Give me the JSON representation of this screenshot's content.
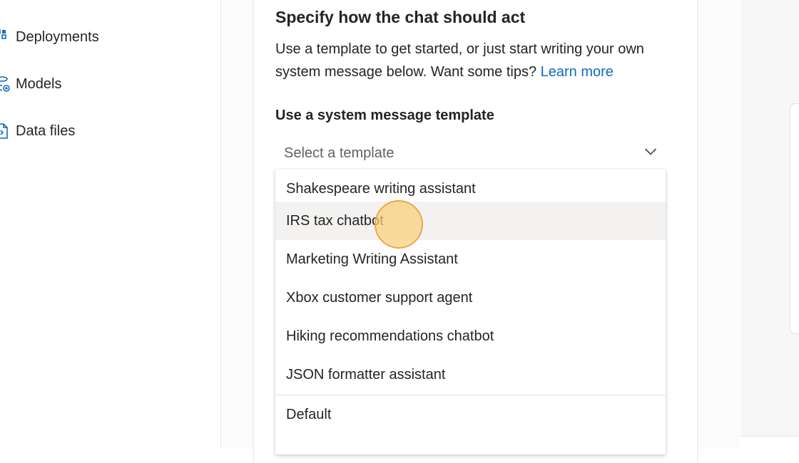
{
  "sidebar": {
    "items": [
      {
        "label": "Deployments",
        "icon": "deployments-icon"
      },
      {
        "label": "Models",
        "icon": "models-icon"
      },
      {
        "label": "Data files",
        "icon": "data-files-icon"
      }
    ]
  },
  "main": {
    "section_title": "Specify how the chat should act",
    "description": "Use a template to get started, or just start writing your own system message below. Want some tips?",
    "learn_more": "Learn more",
    "template_label": "Use a system message template",
    "template_dropdown": {
      "placeholder": "Select a template",
      "hovered_option": "IRS tax chatbot",
      "options": [
        "Shakespeare writing assistant",
        "IRS tax chatbot",
        "Marketing Writing Assistant",
        "Xbox customer support agent",
        "Hiking recommendations chatbot",
        "JSON formatter assistant",
        "Default"
      ]
    }
  },
  "colors": {
    "link": "#0f6cbd",
    "icon": "#0f6cbd",
    "hover_background": "#f3f2f1",
    "click_indicator": "#fbce78"
  }
}
